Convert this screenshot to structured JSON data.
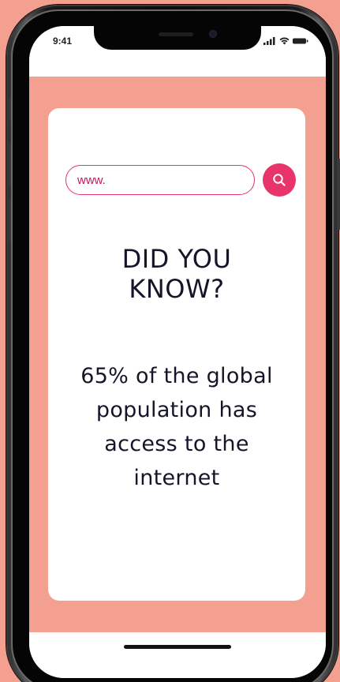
{
  "status_bar": {
    "time": "9:41"
  },
  "search": {
    "value": "www.",
    "button_icon": "search-icon"
  },
  "content": {
    "headline_line1": "DID YOU",
    "headline_line2": "KNOW?",
    "fact_line1": "65% of the global",
    "fact_line2": "population has",
    "fact_line3": "access to the",
    "fact_line4": "internet"
  },
  "colors": {
    "background": "#f4a090",
    "accent": "#e8336b",
    "text": "#15152a",
    "card": "#ffffff"
  }
}
